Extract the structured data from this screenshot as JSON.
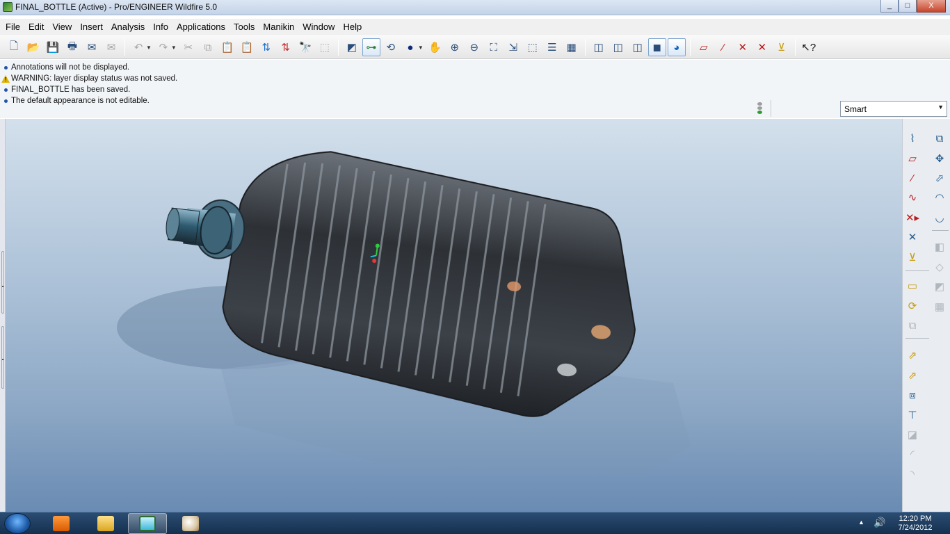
{
  "window": {
    "title": "FINAL_BOTTLE (Active) - Pro/ENGINEER Wildfire 5.0",
    "controls": [
      "_",
      "□",
      "X"
    ]
  },
  "menu": [
    "File",
    "Edit",
    "View",
    "Insert",
    "Analysis",
    "Info",
    "Applications",
    "Tools",
    "Manikin",
    "Window",
    "Help"
  ],
  "toolbar_icons": [
    "new-icon",
    "open-icon",
    "save-icon",
    "print-icon",
    "email-icon",
    "email-link-icon",
    "undo-icon",
    "redo-icon",
    "cut-icon",
    "copy-icon",
    "paste-icon",
    "paste-special-icon",
    "regenerate-icon",
    "regen-manager-icon",
    "find-icon",
    "select-box-icon",
    "repaint-icon",
    "spin-center-icon",
    "orient-mode-icon",
    "appearance-gallery-icon",
    "pan-icon",
    "zoom-in-icon",
    "zoom-out-icon",
    "refit-icon",
    "reorient-icon",
    "saved-views-icon",
    "layers-icon",
    "view-manager-icon",
    "wireframe-icon",
    "hidden-line-icon",
    "no-hidden-icon",
    "shading-icon",
    "enhanced-realism-icon",
    "datum-planes-icon",
    "datum-axes-icon",
    "datum-points-icon",
    "csys-icon",
    "annotations-icon",
    "context-help-icon"
  ],
  "messages": [
    {
      "type": "info",
      "text": "Annotations will not be displayed."
    },
    {
      "type": "warning",
      "text": "WARNING: layer display status was not saved."
    },
    {
      "type": "info",
      "text": "FINAL_BOTTLE has been saved."
    },
    {
      "type": "info",
      "text": "The default appearance is not editable."
    }
  ],
  "filter": {
    "value": "Smart"
  },
  "right_toolbar": {
    "column1": [
      "sketch-datum-curve-icon",
      "datum-plane-icon",
      "datum-axis-icon",
      "datum-curve-icon",
      "datum-point-icon",
      "csys-icon",
      "analysis-feature-icon",
      "extrude-icon",
      "revolve-icon",
      "variable-sweep-icon",
      "blend-icon",
      "edge-chamfer-icon",
      "round-icon",
      "draft-icon",
      "shell-icon",
      "rib-icon",
      "pattern-icon"
    ],
    "column2": [
      "copy-geometry-icon",
      "mirror-icon",
      "merge-icon",
      "trim-icon",
      "offset-icon",
      "thicken-icon",
      "intersect-icon",
      "extend-icon",
      "project-icon",
      "pattern-table-icon",
      "style-icon"
    ]
  },
  "viewport": {
    "model": "FINAL_BOTTLE",
    "colors": {
      "bg_top": "#d3e0ec",
      "bg_bottom": "#6a8bb3",
      "body": "#3a3d42"
    }
  },
  "taskbar": {
    "apps": [
      "media-player-icon",
      "file-explorer-icon",
      "proengineer-icon",
      "paint-icon"
    ],
    "clock_time": "12:20 PM",
    "clock_date": "7/24/2012"
  }
}
